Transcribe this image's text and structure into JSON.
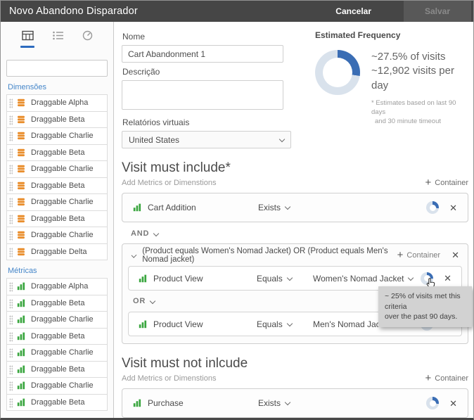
{
  "header": {
    "title": "Novo Abandono Disparador",
    "cancel_label": "Cancelar",
    "save_label": "Salvar"
  },
  "sidebar": {
    "search_placeholder": "",
    "dimensions": {
      "label": "Dimensões",
      "items": [
        "Draggable Alpha",
        "Draggable Beta",
        "Draggable Charlie",
        "Draggable Beta",
        "Draggable Charlie",
        "Draggable Beta",
        "Draggable Charlie",
        "Draggable Beta",
        "Draggable Charlie",
        "Draggable Delta"
      ]
    },
    "metrics": {
      "label": "Métricas",
      "items": [
        "Draggable Alpha",
        "Draggable Beta",
        "Draggable Charlie",
        "Draggable Beta",
        "Draggable Charlie",
        "Draggable Beta",
        "Draggable Charlie",
        "Draggable Beta"
      ]
    }
  },
  "form": {
    "name_label": "Nome",
    "name_value": "Cart Abandonment 1",
    "description_label": "Descrição",
    "description_value": "",
    "virtual_reports_label": "Relatórios virtuais",
    "virtual_reports_value": "United States"
  },
  "estimated_frequency": {
    "title": "Estimated Frequency",
    "percent_value": 27.5,
    "percent_text": "~27.5% of visits",
    "visits_text": "~12,902 visits per day",
    "footnote_line1": "* Estimates based on last 90 days",
    "footnote_line2": "and 30 minute timeout"
  },
  "include_section": {
    "title": "Visit must include*",
    "subtitle": "Add Metrics or Dimenstions",
    "container_label": "Container",
    "row1": {
      "metric": "Cart Addition",
      "operator": "Exists",
      "donut_percent": 27
    },
    "logic1": "AND",
    "nested": {
      "summary": "(Product equals Women's Nomad Jacket) OR (Product equals Men's Nomad jacket)",
      "container_label": "Container",
      "row1": {
        "metric": "Product View",
        "operator": "Equals",
        "value": "Women's Nomad Jacket",
        "donut_percent": 25
      },
      "logic": "OR",
      "row2": {
        "metric": "Product View",
        "operator": "Equals",
        "value": "Men's Nomad Jacket",
        "donut_percent": 25
      }
    },
    "tooltip": {
      "line1": "~ 25% of visits met this criteria",
      "line2": "over the past 90 days."
    }
  },
  "exclude_section": {
    "title": "Visit must not inlcude",
    "subtitle": "Add Metrics or Dimenstions",
    "container_label": "Container",
    "row1": {
      "metric": "Purchase",
      "operator": "Exists",
      "donut_percent": 27
    }
  },
  "glyphs": {
    "close": "✕",
    "plus": "+"
  },
  "icons": {
    "search": "magnifier",
    "freeform_table": "grid-table",
    "components_list": "bulleted-list",
    "gauge": "dial",
    "drag_handle": "dot-grid",
    "dimension": "orange-stack",
    "metric": "green-bars",
    "chevron_down": "chevron",
    "close": "x-mark",
    "donut": "ring-chart",
    "cursor": "hand-pointer"
  },
  "colors": {
    "header_bg": "#464646",
    "accent_blue": "#3a6db4",
    "donut_track": "#d9e2ec",
    "label_blue": "#4586c9",
    "tab_underline": "#2d6bbf",
    "dimension_orange": "#e98d2b",
    "metric_green": "#3aa63f",
    "tooltip_bg": "#d2d2d2"
  }
}
